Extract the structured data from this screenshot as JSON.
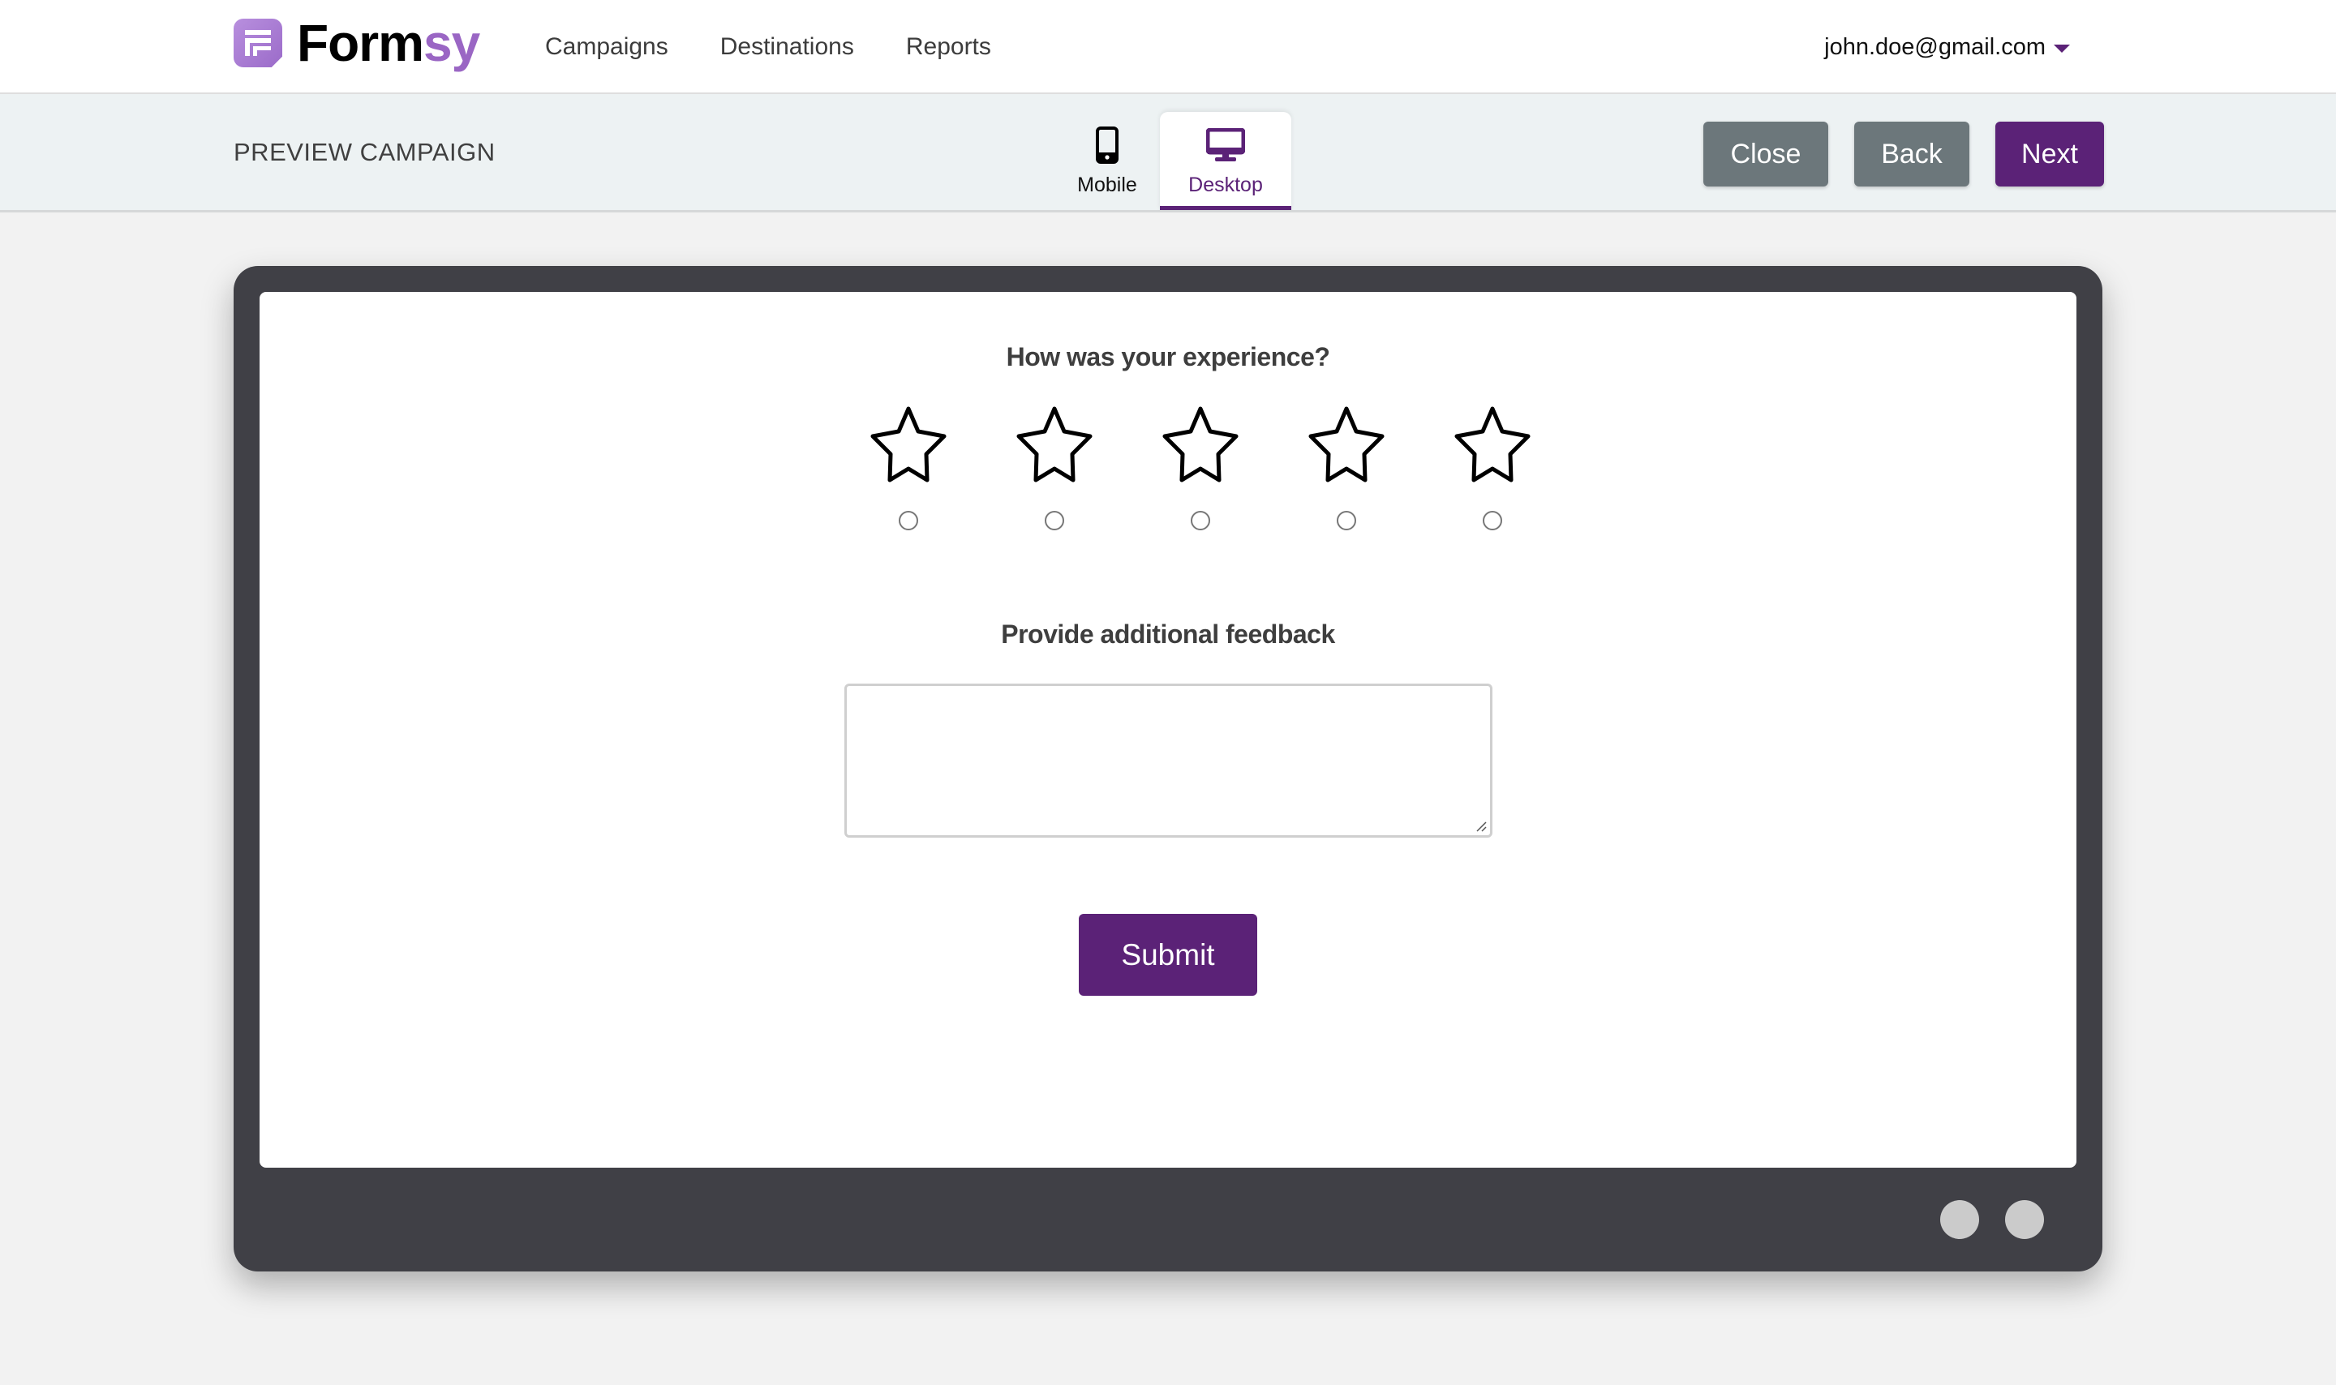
{
  "header": {
    "logo": {
      "text_main": "Form",
      "text_accent": "sy",
      "icon": "formsy-logo-icon"
    },
    "nav": [
      {
        "label": "Campaigns"
      },
      {
        "label": "Destinations"
      },
      {
        "label": "Reports"
      }
    ],
    "user": {
      "email": "john.doe@gmail.com",
      "icon": "caret-down-icon"
    }
  },
  "subheader": {
    "title": "PREVIEW CAMPAIGN",
    "tabs": [
      {
        "label": "Mobile",
        "icon": "mobile-phone-icon",
        "active": false
      },
      {
        "label": "Desktop",
        "icon": "desktop-monitor-icon",
        "active": true
      }
    ],
    "buttons": {
      "close": "Close",
      "back": "Back",
      "next": "Next"
    }
  },
  "preview": {
    "rating_question": "How was your experience?",
    "rating": {
      "max": 5,
      "selected": 0
    },
    "feedback_label": "Provide additional feedback",
    "feedback_value": "",
    "submit_label": "Submit"
  },
  "colors": {
    "brand_purple": "#5b2277",
    "logo_purple": "#9a66c4",
    "secondary_button": "#6c777b",
    "device_frame": "#404046",
    "subheader_bg": "#edf2f3",
    "page_bg": "#f2f2f2"
  }
}
